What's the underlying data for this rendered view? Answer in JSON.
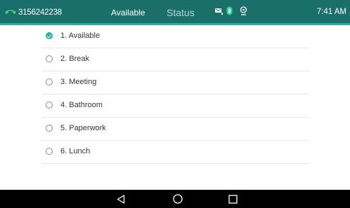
{
  "header": {
    "line_number": "3156242238",
    "availability": "Available",
    "title": "Status",
    "time": "7:41 AM"
  },
  "status_options": [
    {
      "label": "1. Available",
      "selected": true
    },
    {
      "label": "2. Break",
      "selected": false
    },
    {
      "label": "3. Meeting",
      "selected": false
    },
    {
      "label": "4. Bathroom",
      "selected": false
    },
    {
      "label": "5. Paperwork",
      "selected": false
    },
    {
      "label": "6. Lunch",
      "selected": false
    }
  ],
  "icons": {
    "line": "phone-handset-icon",
    "indicators": [
      "voicemail-icon",
      "bluetooth-icon",
      "location-icon"
    ],
    "nav": [
      "back-triangle-icon",
      "home-circle-icon",
      "recents-square-icon"
    ]
  },
  "colors": {
    "header_bg": "#1a6f6a",
    "header_accent": "#18b7a8",
    "selected": "#21b3a4",
    "line_icon": "#43d17a"
  }
}
